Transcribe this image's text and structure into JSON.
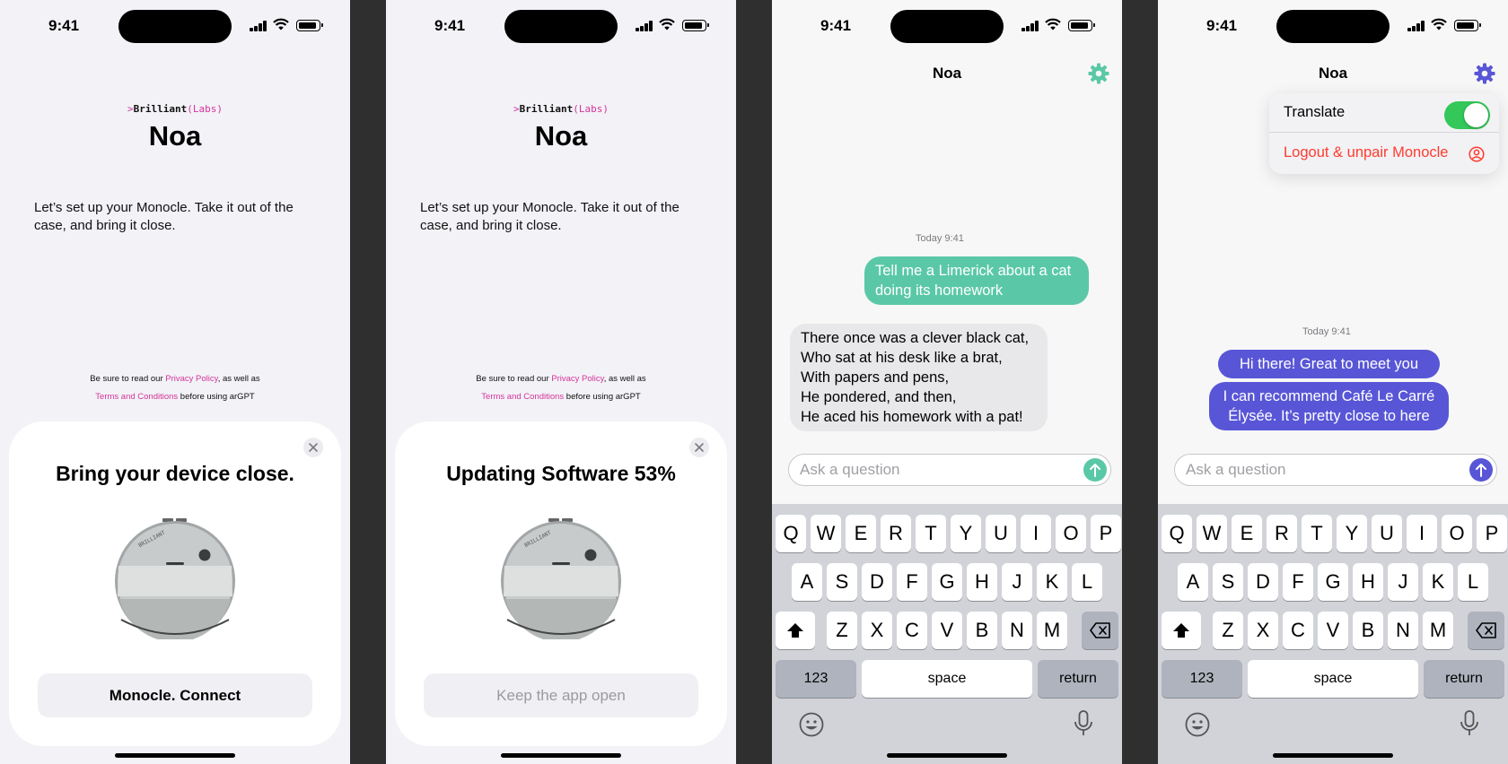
{
  "status_bar": {
    "time": "9:41"
  },
  "onboarding": {
    "brand_chevron": ">",
    "brand_name": "Brilliant",
    "brand_suffix": "(Labs)",
    "app_title": "Noa",
    "intro": "Let’s set up your Monocle. Take it out of the case, and bring it close.",
    "legal": {
      "prefix": "Be sure to read our ",
      "privacy_link": "Privacy Policy",
      "middle": ", as well as",
      "terms_link": "Terms and Conditions",
      "suffix": " before using arGPT"
    }
  },
  "screen1": {
    "sheet_title": "Bring your device close.",
    "button": "Monocle. Connect"
  },
  "screen2": {
    "sheet_title": "Updating Software 53%",
    "update_progress_percent": 53,
    "button": "Keep the app open"
  },
  "device_engraving": "BRILLIANT",
  "chat": {
    "title": "Noa",
    "placeholder": "Ask a question",
    "timestamp": "Today 9:41"
  },
  "screen3": {
    "accent": "#5ac8a6",
    "user_message": [
      "Tell me a Limerick about a cat",
      "doing its homework"
    ],
    "assistant_message": [
      "There once was a clever black cat,",
      "Who sat at his desk like a brat,",
      "With papers and pens,",
      "He pondered, and then,",
      "He aced his homework with a pat!"
    ]
  },
  "screen4": {
    "accent": "#5856d6",
    "messages": [
      [
        "Hi there! Great to meet you"
      ],
      [
        "I can recommend Café Le Carré",
        "Élysée. It’s pretty close to here"
      ]
    ],
    "menu": {
      "translate_label": "Translate",
      "translate_on": true,
      "logout_label": "Logout & unpair Monocle",
      "destructive_color": "#ff3b30"
    }
  },
  "keyboard": {
    "row1": [
      "Q",
      "W",
      "E",
      "R",
      "T",
      "Y",
      "U",
      "I",
      "O",
      "P"
    ],
    "row2": [
      "A",
      "S",
      "D",
      "F",
      "G",
      "H",
      "J",
      "K",
      "L"
    ],
    "row3": [
      "Z",
      "X",
      "C",
      "V",
      "B",
      "N",
      "M"
    ],
    "numbers": "123",
    "space": "space",
    "return": "return",
    "shift_icon": "shift-icon",
    "delete_icon": "backspace-icon",
    "emoji_icon": "emoji-icon",
    "mic_icon": "microphone-icon"
  },
  "colors": {
    "brand_pink": "#d6339b",
    "toggle_on": "#34c759"
  }
}
